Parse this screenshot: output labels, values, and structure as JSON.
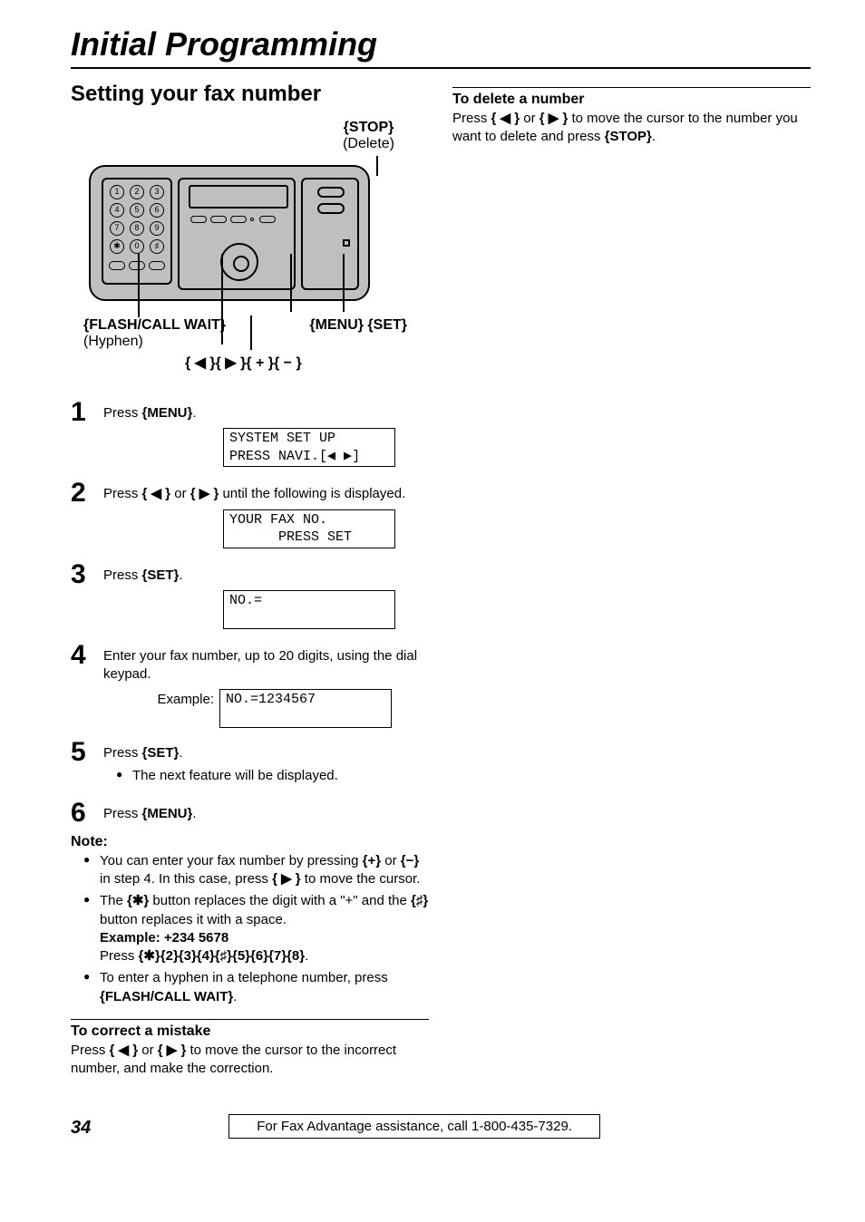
{
  "chapter_title": "Initial Programming",
  "section_title": "Setting your fax number",
  "callouts": {
    "stop": "{STOP}",
    "stop_sub": "(Delete)",
    "flash": "{FLASH/CALL WAIT}",
    "flash_sub": "(Hyphen)",
    "menu_set": "{MENU} {SET}",
    "nav_keys": "{ ◀ }{ ▶ }{ + }{ − }"
  },
  "steps": {
    "s1_a": "Press ",
    "s1_key": "{MENU}",
    "s1_b": ".",
    "lcd1": "SYSTEM SET UP\nPRESS NAVI.[◀ ▶]",
    "s2_a": "Press ",
    "s2_k1": "{ ◀ }",
    "s2_mid": " or ",
    "s2_k2": "{ ▶ }",
    "s2_b": " until the following is displayed.",
    "lcd2": "YOUR FAX NO.\n      PRESS SET",
    "s3_a": "Press ",
    "s3_key": "{SET}",
    "s3_b": ".",
    "lcd3": "NO.=\n ",
    "s4": "Enter your fax number, up to 20 digits, using the dial keypad.",
    "example_label": "Example:",
    "lcd4": "NO.=1234567\n ",
    "s5_a": "Press ",
    "s5_key": "{SET}",
    "s5_b": ".",
    "s5_bullet": "The next feature will be displayed.",
    "s6_a": "Press ",
    "s6_key": "{MENU}",
    "s6_b": "."
  },
  "note": {
    "head": "Note:",
    "n1_a": "You can enter your fax number by pressing ",
    "n1_k1": "{+}",
    "n1_mid": " or ",
    "n1_k2": "{−}",
    "n1_b": " in step 4. In this case, press ",
    "n1_k3": "{ ▶ }",
    "n1_c": " to move the cursor.",
    "n2_a": "The ",
    "n2_k1": "{✱}",
    "n2_b": " button replaces the digit with a \"+\" and the ",
    "n2_k2": "{♯}",
    "n2_c": " button replaces it with a space.",
    "n2_ex_head": "Example: +234 5678",
    "n2_press": "Press ",
    "n2_seq": "{✱}{2}{3}{4}{♯}{5}{6}{7}{8}",
    "n2_dot": ".",
    "n3_a": "To enter a hyphen in a telephone number, press ",
    "n3_k": "{FLASH/CALL WAIT}",
    "n3_b": "."
  },
  "correct": {
    "head": "To correct a mistake",
    "a": "Press ",
    "k1": "{ ◀ }",
    "mid": " or ",
    "k2": "{ ▶ }",
    "b": " to move the cursor to the incorrect number, and make the correction."
  },
  "delete": {
    "head": "To delete a number",
    "a": "Press ",
    "k1": "{ ◀ }",
    "mid": " or ",
    "k2": "{ ▶ }",
    "b": " to move the cursor to the number you want to delete and press ",
    "k3": "{STOP}",
    "c": "."
  },
  "footer": {
    "page": "34",
    "text": "For Fax Advantage assistance, call 1-800-435-7329."
  }
}
